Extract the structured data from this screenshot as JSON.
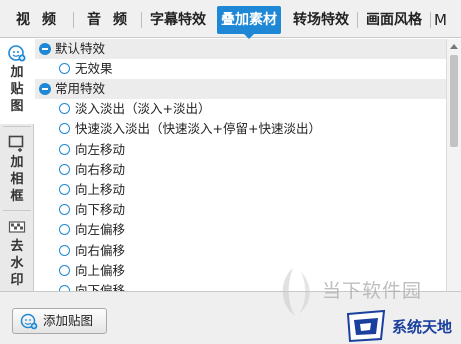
{
  "top_tabs": [
    {
      "label": "视频"
    },
    {
      "label": "音频"
    },
    {
      "label": "字幕特效"
    },
    {
      "label": "叠加素材"
    },
    {
      "label": "转场特效"
    },
    {
      "label": "画面风格"
    },
    {
      "label": "M"
    }
  ],
  "active_top_tab": "叠加素材",
  "side_tabs": [
    {
      "label": "加贴图",
      "icon": "add-sticker-icon"
    },
    {
      "label": "加相框",
      "icon": "add-frame-icon"
    },
    {
      "label": "去水印",
      "icon": "remove-watermark-icon"
    }
  ],
  "groups": [
    {
      "title": "默认特效",
      "items": [
        "无效果"
      ]
    },
    {
      "title": "常用特效",
      "items": [
        "淡入淡出（淡入+淡出）",
        "快速淡入淡出（快速淡入+停留+快速淡出）",
        "向左移动",
        "向右移动",
        "向上移动",
        "向下移动",
        "向左偏移",
        "向右偏移",
        "向上偏移",
        "向下偏移"
      ]
    }
  ],
  "bottom": {
    "add_button_label": "添加贴图"
  },
  "watermarks": {
    "site1": "当下软件园",
    "site2": "系统天地"
  },
  "colors": {
    "accent": "#1e88d6",
    "panel_bg": "#f0f0f0",
    "group_bg": "#ececec",
    "brand_blue": "#1a3f9e"
  }
}
